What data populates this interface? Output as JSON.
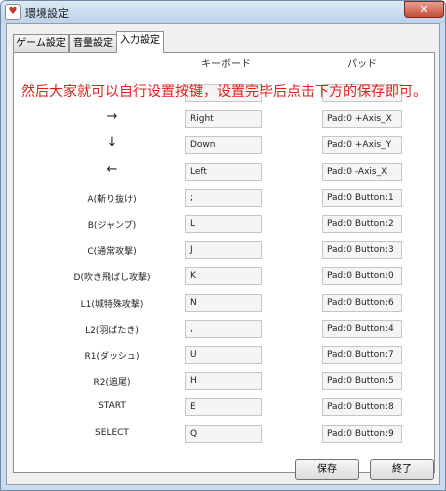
{
  "window": {
    "title": "環境設定",
    "close_symbol": "✕",
    "app_icon_symbol": "♥"
  },
  "tabs": [
    {
      "label": "ゲーム設定"
    },
    {
      "label": "音量設定"
    },
    {
      "label": "入力設定"
    }
  ],
  "columns": {
    "keyboard": "キーボード",
    "pad": "パッド"
  },
  "annotation": "然后大家就可以自行设置按键，设置完毕后点击下方的保存即可。",
  "rows": [
    {
      "label": "",
      "key": "",
      "pad": ""
    },
    {
      "label": "→",
      "key": "Right",
      "pad": "Pad:0 +Axis_X"
    },
    {
      "label": "↓",
      "key": "Down",
      "pad": "Pad:0 +Axis_Y"
    },
    {
      "label": "←",
      "key": "Left",
      "pad": "Pad:0 -Axis_X"
    },
    {
      "label": "A(斬り抜け)",
      "key": ";",
      "pad": "Pad:0 Button:1"
    },
    {
      "label": "B(ジャンプ)",
      "key": "L",
      "pad": "Pad:0 Button:2"
    },
    {
      "label": "C(通常攻撃)",
      "key": "J",
      "pad": "Pad:0 Button:3"
    },
    {
      "label": "D(吹き飛ばし攻撃)",
      "key": "K",
      "pad": "Pad:0 Button:0"
    },
    {
      "label": "L1(城特殊攻撃)",
      "key": "N",
      "pad": "Pad:0 Button:6"
    },
    {
      "label": "L2(羽ばたき)",
      "key": ",",
      "pad": "Pad:0 Button:4"
    },
    {
      "label": "R1(ダッシュ)",
      "key": "U",
      "pad": "Pad:0 Button:7"
    },
    {
      "label": "R2(追尾)",
      "key": "H",
      "pad": "Pad:0 Button:5"
    },
    {
      "label": "START",
      "key": "E",
      "pad": "Pad:0 Button:8"
    },
    {
      "label": "SELECT",
      "key": "Q",
      "pad": "Pad:0 Button:9"
    }
  ],
  "buttons": {
    "save": "保存",
    "close": "終了"
  },
  "colors": {
    "accent_text": "#e0201c",
    "window_frame": "#c9dcee",
    "close_button": "#c24b36"
  }
}
